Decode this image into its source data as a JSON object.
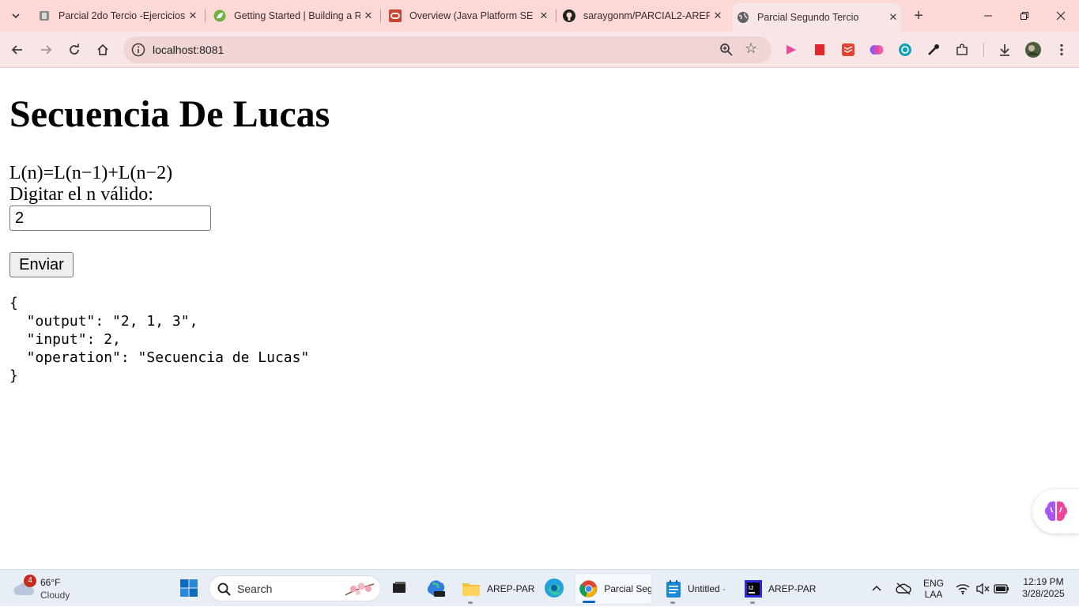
{
  "browser": {
    "tabs": [
      {
        "title": "Parcial 2do Tercio -Ejercicios",
        "active": false
      },
      {
        "title": "Getting Started | Building a R",
        "active": false
      },
      {
        "title": "Overview (Java Platform SE 8",
        "active": false
      },
      {
        "title": "saraygonm/PARCIAL2-AREP",
        "active": false
      },
      {
        "title": "Parcial Segundo Tercio",
        "active": true
      }
    ],
    "url": "localhost:8081"
  },
  "page": {
    "heading": "Secuencia De Lucas",
    "formula": "L(n)=L(n−1)+L(n−2)",
    "prompt": "Digitar el n válido:",
    "input_value": "2",
    "submit_label": "Enviar",
    "result_json": "{\n  \"output\": \"2, 1, 3\",\n  \"input\": 2,\n  \"operation\": \"Secuencia de Lucas\"\n}"
  },
  "taskbar": {
    "weather": {
      "badge": "4",
      "temp": "66°F",
      "condition": "Cloudy"
    },
    "search_label": "Search",
    "apps": [
      {
        "label": "AREP-PAR"
      },
      {
        "label": "Parcial Seg"
      },
      {
        "label": "Untitled ·"
      },
      {
        "label": "AREP-PAR"
      }
    ],
    "language": "ENG",
    "layout": "LAA",
    "time": "12:19 PM",
    "date": "3/28/2025"
  }
}
